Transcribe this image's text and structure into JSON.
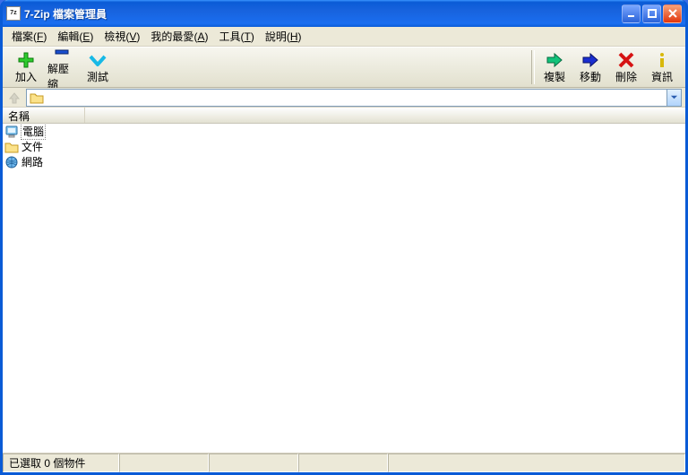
{
  "window": {
    "title": "7-Zip 檔案管理員",
    "app_icon_text": "7z"
  },
  "menu": {
    "file": {
      "label": "檔案",
      "key": "F"
    },
    "edit": {
      "label": "編輯",
      "key": "E"
    },
    "view": {
      "label": "檢視",
      "key": "V"
    },
    "fav": {
      "label": "我的最愛",
      "key": "A"
    },
    "tools": {
      "label": "工具",
      "key": "T"
    },
    "help": {
      "label": "說明",
      "key": "H"
    }
  },
  "toolbar": {
    "add": "加入",
    "extract": "解壓縮",
    "test": "測試",
    "copy": "複製",
    "move": "移動",
    "delete": "刪除",
    "info": "資訊"
  },
  "address": {
    "path": ""
  },
  "columns": {
    "name": "名稱"
  },
  "items": [
    {
      "name": "電腦",
      "icon": "computer",
      "selected": true
    },
    {
      "name": "文件",
      "icon": "folder",
      "selected": false
    },
    {
      "name": "網路",
      "icon": "network",
      "selected": false
    }
  ],
  "status": {
    "text": "已選取 0 個物件"
  }
}
